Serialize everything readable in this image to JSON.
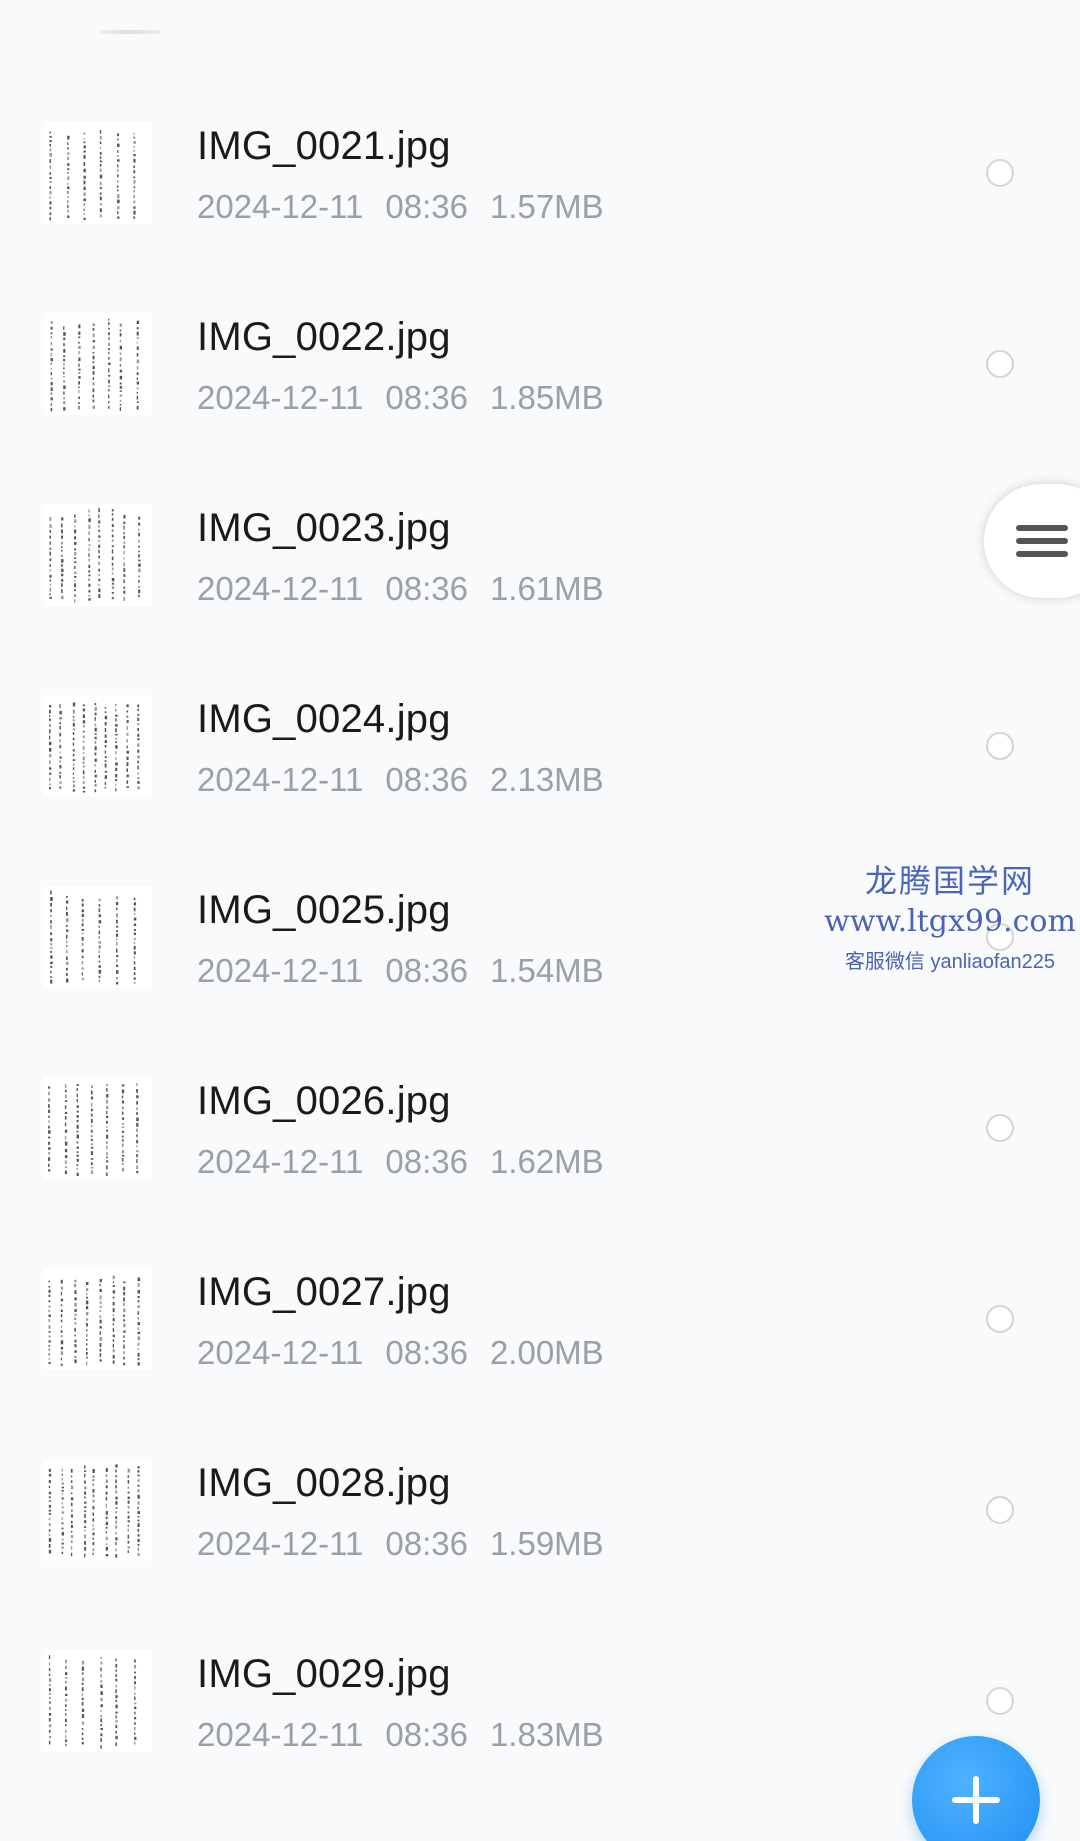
{
  "files": [
    {
      "name": "IMG_0021.jpg",
      "date": "2024-12-11",
      "time": "08:36",
      "size": "1.57MB"
    },
    {
      "name": "IMG_0022.jpg",
      "date": "2024-12-11",
      "time": "08:36",
      "size": "1.85MB"
    },
    {
      "name": "IMG_0023.jpg",
      "date": "2024-12-11",
      "time": "08:36",
      "size": "1.61MB"
    },
    {
      "name": "IMG_0024.jpg",
      "date": "2024-12-11",
      "time": "08:36",
      "size": "2.13MB"
    },
    {
      "name": "IMG_0025.jpg",
      "date": "2024-12-11",
      "time": "08:36",
      "size": "1.54MB"
    },
    {
      "name": "IMG_0026.jpg",
      "date": "2024-12-11",
      "time": "08:36",
      "size": "1.62MB"
    },
    {
      "name": "IMG_0027.jpg",
      "date": "2024-12-11",
      "time": "08:36",
      "size": "2.00MB"
    },
    {
      "name": "IMG_0028.jpg",
      "date": "2024-12-11",
      "time": "08:36",
      "size": "1.59MB"
    },
    {
      "name": "IMG_0029.jpg",
      "date": "2024-12-11",
      "time": "08:36",
      "size": "1.83MB"
    }
  ],
  "watermark": {
    "title": "龙腾国学网",
    "url": "www.ltgx99.com",
    "contact": "客服微信 yanliaofan225"
  },
  "icons": {
    "side_menu": "hamburger-menu-icon",
    "fab": "plus-icon",
    "row_select": "radio-circle-icon"
  },
  "colors": {
    "accent": "#1e8ff2",
    "watermark": "#4b63b5",
    "meta_text": "#9aa0a6"
  }
}
